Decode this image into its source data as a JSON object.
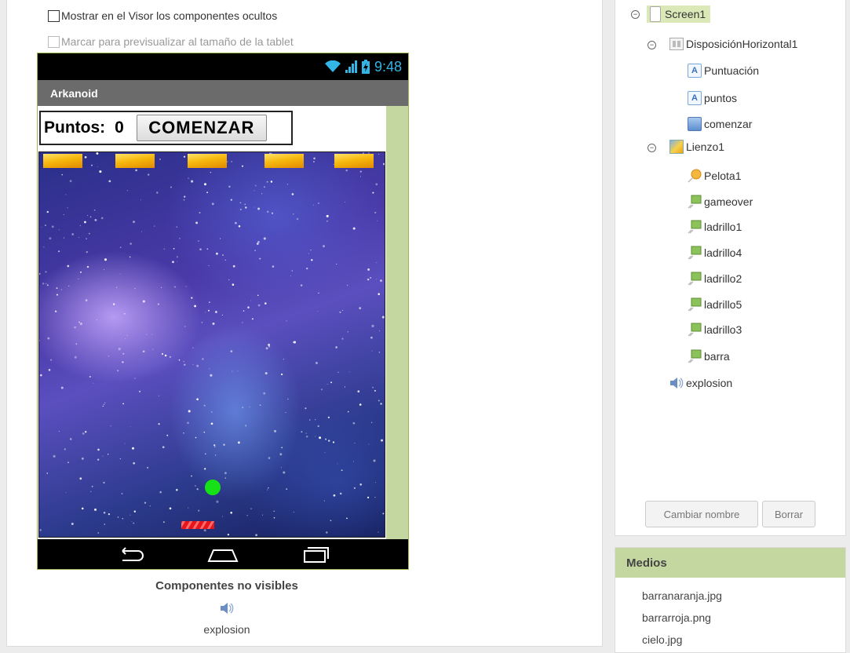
{
  "viewer": {
    "show_hidden_label": "Mostrar en el Visor los componentes ocultos",
    "tablet_preview_label": "Marcar para previsualizar al tamaño de la tablet",
    "status_time": "9:48",
    "app_title": "Arkanoid",
    "score_label": "Puntos:",
    "score_value": "0",
    "start_button": "COMENZAR",
    "non_visible_title": "Componentes no visibles",
    "non_visible_items": [
      "explosion"
    ]
  },
  "tree": {
    "nodes": [
      {
        "label": "Screen1"
      },
      {
        "label": "DisposiciónHorizontal1"
      },
      {
        "label": "Puntuación"
      },
      {
        "label": "puntos"
      },
      {
        "label": "comenzar"
      },
      {
        "label": "Lienzo1"
      },
      {
        "label": "Pelota1"
      },
      {
        "label": "gameover"
      },
      {
        "label": "ladrillo1"
      },
      {
        "label": "ladrillo4"
      },
      {
        "label": "ladrillo2"
      },
      {
        "label": "ladrillo5"
      },
      {
        "label": "ladrillo3"
      },
      {
        "label": "barra"
      },
      {
        "label": "explosion"
      }
    ],
    "rename_button": "Cambiar nombre",
    "delete_button": "Borrar"
  },
  "media": {
    "title": "Medios",
    "files": [
      "barranaranja.jpg",
      "barrarroja.png",
      "cielo.jpg"
    ]
  },
  "colors": {
    "accent_green": "#c5d7a1",
    "status_blue": "#33b5e5"
  }
}
